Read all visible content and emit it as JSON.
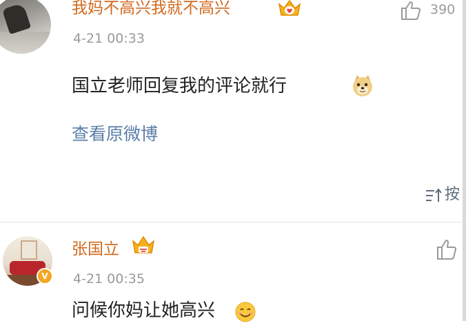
{
  "comments": [
    {
      "username": "我妈不高兴我就不高兴",
      "timestamp": "4-21 00:33",
      "content": "国立老师回复我的评论就行",
      "content_emoji": "doge-emoji",
      "view_original": "查看原微博",
      "likes": "390",
      "badge_icon": "crown-badge-icon"
    },
    {
      "username": "张国立",
      "timestamp": "4-21 00:35",
      "content": "问候你妈让她高兴",
      "content_emoji": "smile-emoji",
      "badge_icon": "crown-badge-icon",
      "verified": "V"
    }
  ],
  "sort": {
    "label": "按"
  },
  "colors": {
    "username": "#d2691e",
    "link": "#5b7ea8",
    "timestamp": "#9a9a9a"
  }
}
